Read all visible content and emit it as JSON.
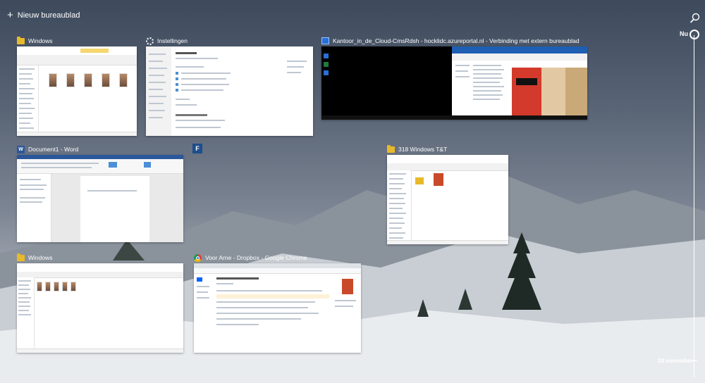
{
  "header": {
    "new_desktop_label": "Nieuw bureaublad"
  },
  "timeline": {
    "now_label": "Nu",
    "date_label": "24 november"
  },
  "windows": [
    {
      "title": "Windows",
      "app": "folder-icon"
    },
    {
      "title": "Instellingen",
      "app": "gear-icon"
    },
    {
      "title": "Kantoor_in_de_Cloud-CmsRdsh - hocklidc.azureportal.nl - Verbinding met extern bureaublad",
      "app": "remote-desktop-icon"
    },
    {
      "title": "Document1 - Word",
      "app": "word-icon"
    },
    {
      "title": "F",
      "app": "f-app-icon"
    },
    {
      "title": "318 Windows T&T",
      "app": "folder-icon"
    },
    {
      "title": "Windows",
      "app": "folder-icon"
    },
    {
      "title": "Voor Arne - Dropbox - Google Chrome",
      "app": "chrome-icon"
    }
  ],
  "colors": {
    "folder": "#e8b92a",
    "word": "#2b579a",
    "accent": "#4a8fd8"
  }
}
